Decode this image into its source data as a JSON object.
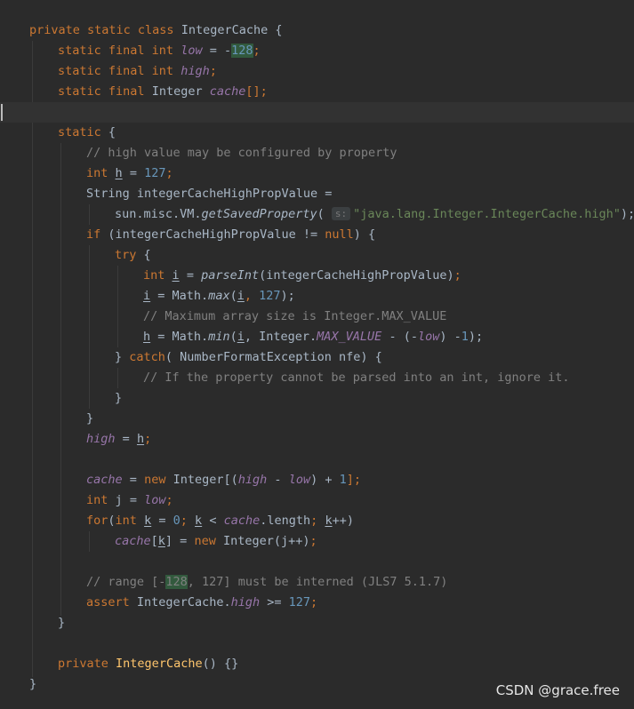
{
  "watermark": "CSDN @grace.free",
  "code": {
    "class_decl": {
      "kw": "private static class",
      "name": "IntegerCache",
      "brace": "{"
    },
    "low_decl": {
      "kw": "static final int",
      "name": "low",
      "eq": "=",
      "minus": "-",
      "value": "128",
      "semi": ";"
    },
    "high_decl": {
      "kw": "static final int",
      "name": "high",
      "semi": ";"
    },
    "cache_decl": {
      "kw": "static final",
      "type": "Integer",
      "name": "cache",
      "rest": "[];"
    },
    "static_block": {
      "kw": "static",
      "brace": "{"
    },
    "comment_property": "// high value may be configured by property",
    "h_decl": {
      "kw": "int",
      "var": "h",
      "eq": "=",
      "value": "127",
      "semi": ";"
    },
    "prop_decl": "String integerCacheHighPropValue =",
    "get_saved": {
      "prefix": "sun.misc.VM.",
      "method": "getSavedProperty",
      "paren": "(",
      "hint": "s:",
      "arg": "\"java.lang.Integer.IntegerCache.high\"",
      "end": ");"
    },
    "if_stmt": {
      "kw": "if",
      "cond": "(integerCacheHighPropValue !=",
      "null": "null",
      "end": ") {"
    },
    "try_stmt": {
      "kw": "try",
      "brace": "{"
    },
    "i_decl": {
      "kw": "int",
      "var": "i",
      "eq": "=",
      "method": "parseInt",
      "args": "(integerCacheHighPropValue)",
      "semi": ";"
    },
    "i_max": {
      "var": "i",
      "eq": "= Math.",
      "method": "max",
      "open": "(",
      "arg": "i",
      "sep": ",",
      "value": "127",
      "end": ");"
    },
    "comment_max_array": "// Maximum array size is Integer.MAX_VALUE",
    "h_min": {
      "var": "h",
      "eq": "= Math.",
      "method": "min",
      "open": "(",
      "arg": "i",
      "sep": ", Integer.",
      "const": "MAX_VALUE",
      "minus": "- (-",
      "low": "low",
      "close": ") -",
      "value": "1",
      "end": ");"
    },
    "catch_stmt": {
      "close": "}",
      "kw": "catch",
      "rest": "( NumberFormatException nfe) {"
    },
    "comment_ignore": "// If the property cannot be parsed into an int, ignore it.",
    "close_catch": "}",
    "close_if": "}",
    "high_assign": {
      "name": "high",
      "eq": "=",
      "var": "h",
      "semi": ";"
    },
    "cache_new": {
      "name": "cache",
      "eq": "=",
      "kw": "new",
      "type": "Integer[(",
      "high": "high",
      "minus": "-",
      "low": "low",
      "plus": ") +",
      "value": "1",
      "end": "];"
    },
    "j_decl": {
      "kw": "int",
      "var": "j",
      "eq": "=",
      "low": "low",
      "semi": ";"
    },
    "for_stmt": {
      "kw": "for",
      "open": "(",
      "kw2": "int",
      "var": "k",
      "eq": "=",
      "value": "0",
      "semi1": ";",
      "var2": "k",
      "lt": "<",
      "cache": "cache",
      "len": ".length",
      "semi2": ";",
      "var3": "k",
      "inc": "++)"
    },
    "cache_assign": {
      "name": "cache",
      "open": "[",
      "var": "k",
      "close": "] =",
      "kw": "new",
      "rest": "Integer(j++)",
      "semi": ";"
    },
    "comment_range": {
      "pre": "// range [-",
      "value": "128",
      "post": ", 127] must be interned (JLS7 5.1.7)"
    },
    "assert_stmt": {
      "kw": "assert",
      "prefix": "IntegerCache.",
      "name": "high",
      "op": ">=",
      "value": "127",
      "semi": ";"
    },
    "close_static": "}",
    "ctor": {
      "kw": "private",
      "name": "IntegerCache",
      "rest": "() {}"
    },
    "close_class": "}"
  }
}
